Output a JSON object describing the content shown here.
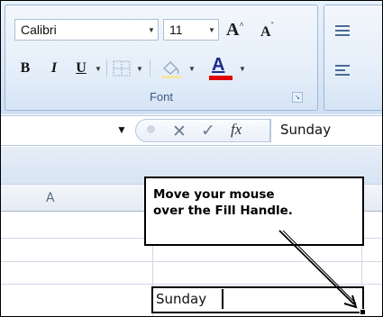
{
  "ribbon": {
    "font_group": {
      "font_name": "Calibri",
      "font_size": "11",
      "grow_font_letter": "A",
      "shrink_font_letter": "A",
      "bold_label": "B",
      "italic_label": "I",
      "underline_label": "U",
      "font_color_letter": "A",
      "group_label": "Font",
      "launcher_glyph": "↘",
      "icons": [
        "grow-font-icon",
        "shrink-font-icon",
        "borders-icon",
        "fill-color-icon",
        "font-color-icon",
        "dialog-launcher-icon"
      ]
    },
    "alignment_group": {
      "icons": [
        "align-top-icon",
        "align-left-icon"
      ]
    }
  },
  "formula_bar": {
    "cancel_glyph": "✕",
    "enter_glyph": "✓",
    "insert_function_label": "fx",
    "content": "Sunday"
  },
  "sheet": {
    "column_header_a": "A",
    "active_cell_value": "Sunday"
  },
  "callout": {
    "text": "Move your mouse\nover the Fill Handle."
  },
  "colors": {
    "font_color_bar": "#e00000",
    "ribbon_bg": "#dde9f7",
    "group_label": "#3b5a86"
  }
}
